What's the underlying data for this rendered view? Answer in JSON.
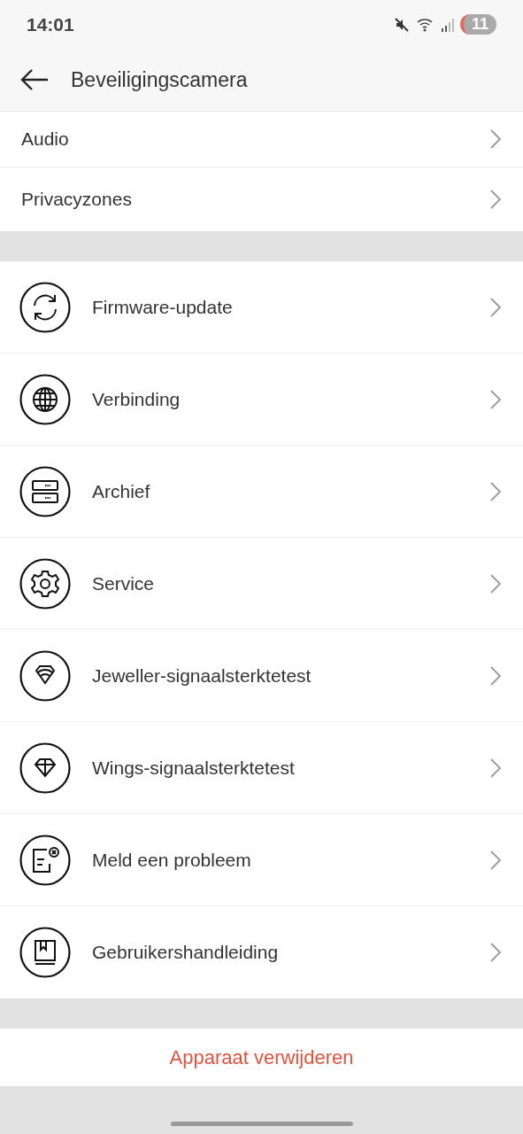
{
  "status_bar": {
    "time": "14:01",
    "battery": "11"
  },
  "header": {
    "title": "Beveiligingscamera"
  },
  "top_items": [
    {
      "label": "Audio"
    },
    {
      "label": "Privacyzones"
    }
  ],
  "items": [
    {
      "kind": "update",
      "label": "Firmware-update"
    },
    {
      "kind": "globe",
      "label": "Verbinding"
    },
    {
      "kind": "archive",
      "label": "Archief"
    },
    {
      "kind": "gear",
      "label": "Service"
    },
    {
      "kind": "jeweller",
      "label": "Jeweller-signaalsterktetest"
    },
    {
      "kind": "wings",
      "label": "Wings-signaalsterktetest"
    },
    {
      "kind": "report",
      "label": "Meld een probleem"
    },
    {
      "kind": "manual",
      "label": "Gebruikershandleiding"
    }
  ],
  "delete_button": "Apparaat verwijderen"
}
